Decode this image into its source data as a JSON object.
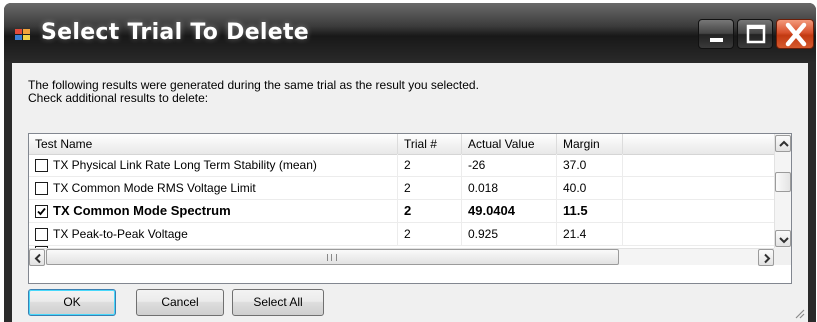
{
  "window": {
    "title": "Select Trial To Delete"
  },
  "description": {
    "line1": "The following results were generated during the same trial as the result you selected.",
    "line2": "Check additional results to delete:"
  },
  "table": {
    "headers": [
      "Test Name",
      "Trial #",
      "Actual Value",
      "Margin"
    ],
    "rows": [
      {
        "name": "TX Physical Link Rate Long Term Stability (mean)",
        "trial": "2",
        "actual": "-26",
        "margin": "37.0",
        "checked": false
      },
      {
        "name": "TX Common Mode RMS Voltage Limit",
        "trial": "2",
        "actual": "0.018",
        "margin": "40.0",
        "checked": false
      },
      {
        "name": "TX Common Mode Spectrum",
        "trial": "2",
        "actual": "49.0404",
        "margin": "11.5",
        "checked": true
      },
      {
        "name": "TX Peak-to-Peak Voltage",
        "trial": "2",
        "actual": "0.925",
        "margin": "21.4",
        "checked": false
      }
    ]
  },
  "buttons": {
    "ok": "OK",
    "cancel": "Cancel",
    "select_all": "Select All"
  },
  "icons": {
    "app": "app-icon",
    "minimize": "minimize-icon",
    "maximize": "maximize-icon",
    "close": "close-icon",
    "checkbox_checked": "checkmark-icon",
    "scroll_up": "chevron-up-icon",
    "scroll_down": "chevron-down-icon",
    "scroll_left": "chevron-left-icon",
    "scroll_right": "chevron-right-icon"
  },
  "colors": {
    "titlebar": "#2a2a2a",
    "close_button": "#d8512c",
    "client_background": "#f0f0f0",
    "default_button_border": "#3c7fb1"
  }
}
